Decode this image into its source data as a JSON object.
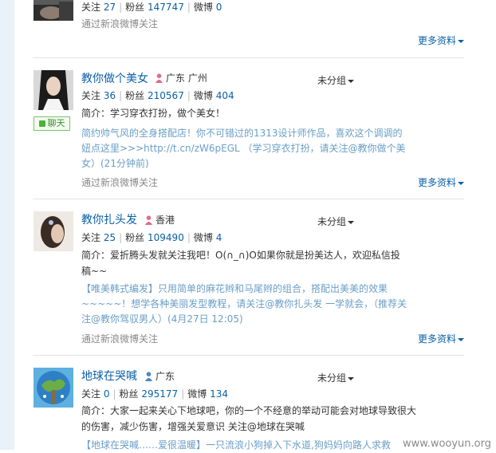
{
  "users": [
    {
      "name": "",
      "location": "",
      "gender": "",
      "stats": {
        "follow_label": "关注",
        "follow": "27",
        "fans_label": "粉丝",
        "fans": "147747",
        "weibo_label": "微博",
        "weibo": "0"
      },
      "via": "通过新浪微博关注",
      "more": "更多资料"
    },
    {
      "name": "教你做个美女",
      "location": "广东 广州",
      "gender": "female",
      "group": "未分组",
      "chat": "聊天",
      "stats": {
        "follow_label": "关注",
        "follow": "36",
        "fans_label": "粉丝",
        "fans": "210567",
        "weibo_label": "微博",
        "weibo": "404"
      },
      "intro": "简介：学习穿衣打扮，做个美女！",
      "recent": "简约帅气风的全身搭配店！你不可错过的1313设计师作品，喜欢这个调调的妞点这里>>>http://t.cn/zW6pEGL （学习穿衣打扮，请关注@教你做个美女）(21分钟前)",
      "via": "通过新浪微博关注",
      "more": "更多资料"
    },
    {
      "name": "教你扎头发",
      "location": "香港",
      "gender": "female",
      "group": "未分组",
      "stats": {
        "follow_label": "关注",
        "follow": "25",
        "fans_label": "粉丝",
        "fans": "109490",
        "weibo_label": "微博",
        "weibo": "4"
      },
      "intro": "简介：爱折腾头发就关注我吧！O(∩_∩)O如果你就是扮美达人，欢迎私信投稿~~",
      "recent": "【唯美韩式编发】只用简单的麻花辫和马尾辫的组合，搭配出美美的效果~~~~~！想学各种美丽发型教程，请关注@教你扎头发 一学就会，（推荐关注@教你驾驭男人）(4月27日 12:05)",
      "via": "通过新浪微博关注",
      "more": "更多资料"
    },
    {
      "name": "地球在哭喊",
      "location": "广东",
      "gender": "male",
      "group": "未分组",
      "stats": {
        "follow_label": "关注",
        "follow": "0",
        "fans_label": "粉丝",
        "fans": "295177",
        "weibo_label": "微博",
        "weibo": "134"
      },
      "intro": "简介：大家一起来关心下地球吧，你的一个不经意的举动可能会对地球导致很大的伤害，减少伤害，增强关爱意识 关注@地球在哭喊",
      "recent": "【地球在哭喊……爱很温暖】一只流浪小狗掉入下水道,狗妈妈向路人求救"
    }
  ],
  "colors": {
    "link": "#0a5fa7",
    "recent_text": "#6a9ec6",
    "female_icon": "#e26a8d",
    "male_icon": "#4a86c5"
  },
  "watermark": "www.wooyun.org"
}
